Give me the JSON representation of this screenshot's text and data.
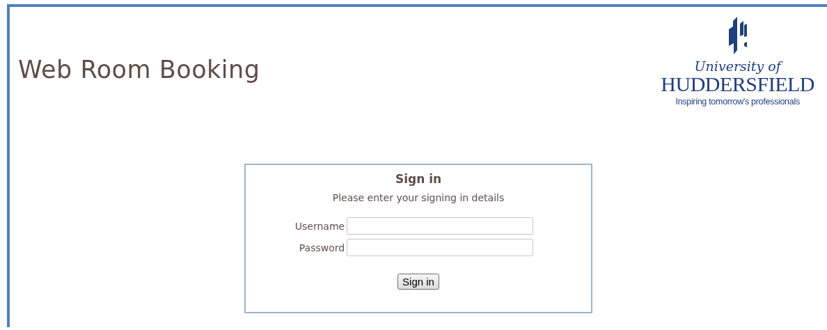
{
  "header": {
    "title": "Web Room Booking",
    "logo": {
      "line_1": "University of",
      "line_2": "HUDDERSFIELD",
      "tagline": "Inspiring tomorrow's professionals"
    }
  },
  "sign_in": {
    "heading": "Sign in",
    "instructions": "Please enter your signing in details",
    "fields": [
      {
        "label": "Username"
      },
      {
        "label": "Password"
      }
    ],
    "button": "Sign in"
  }
}
